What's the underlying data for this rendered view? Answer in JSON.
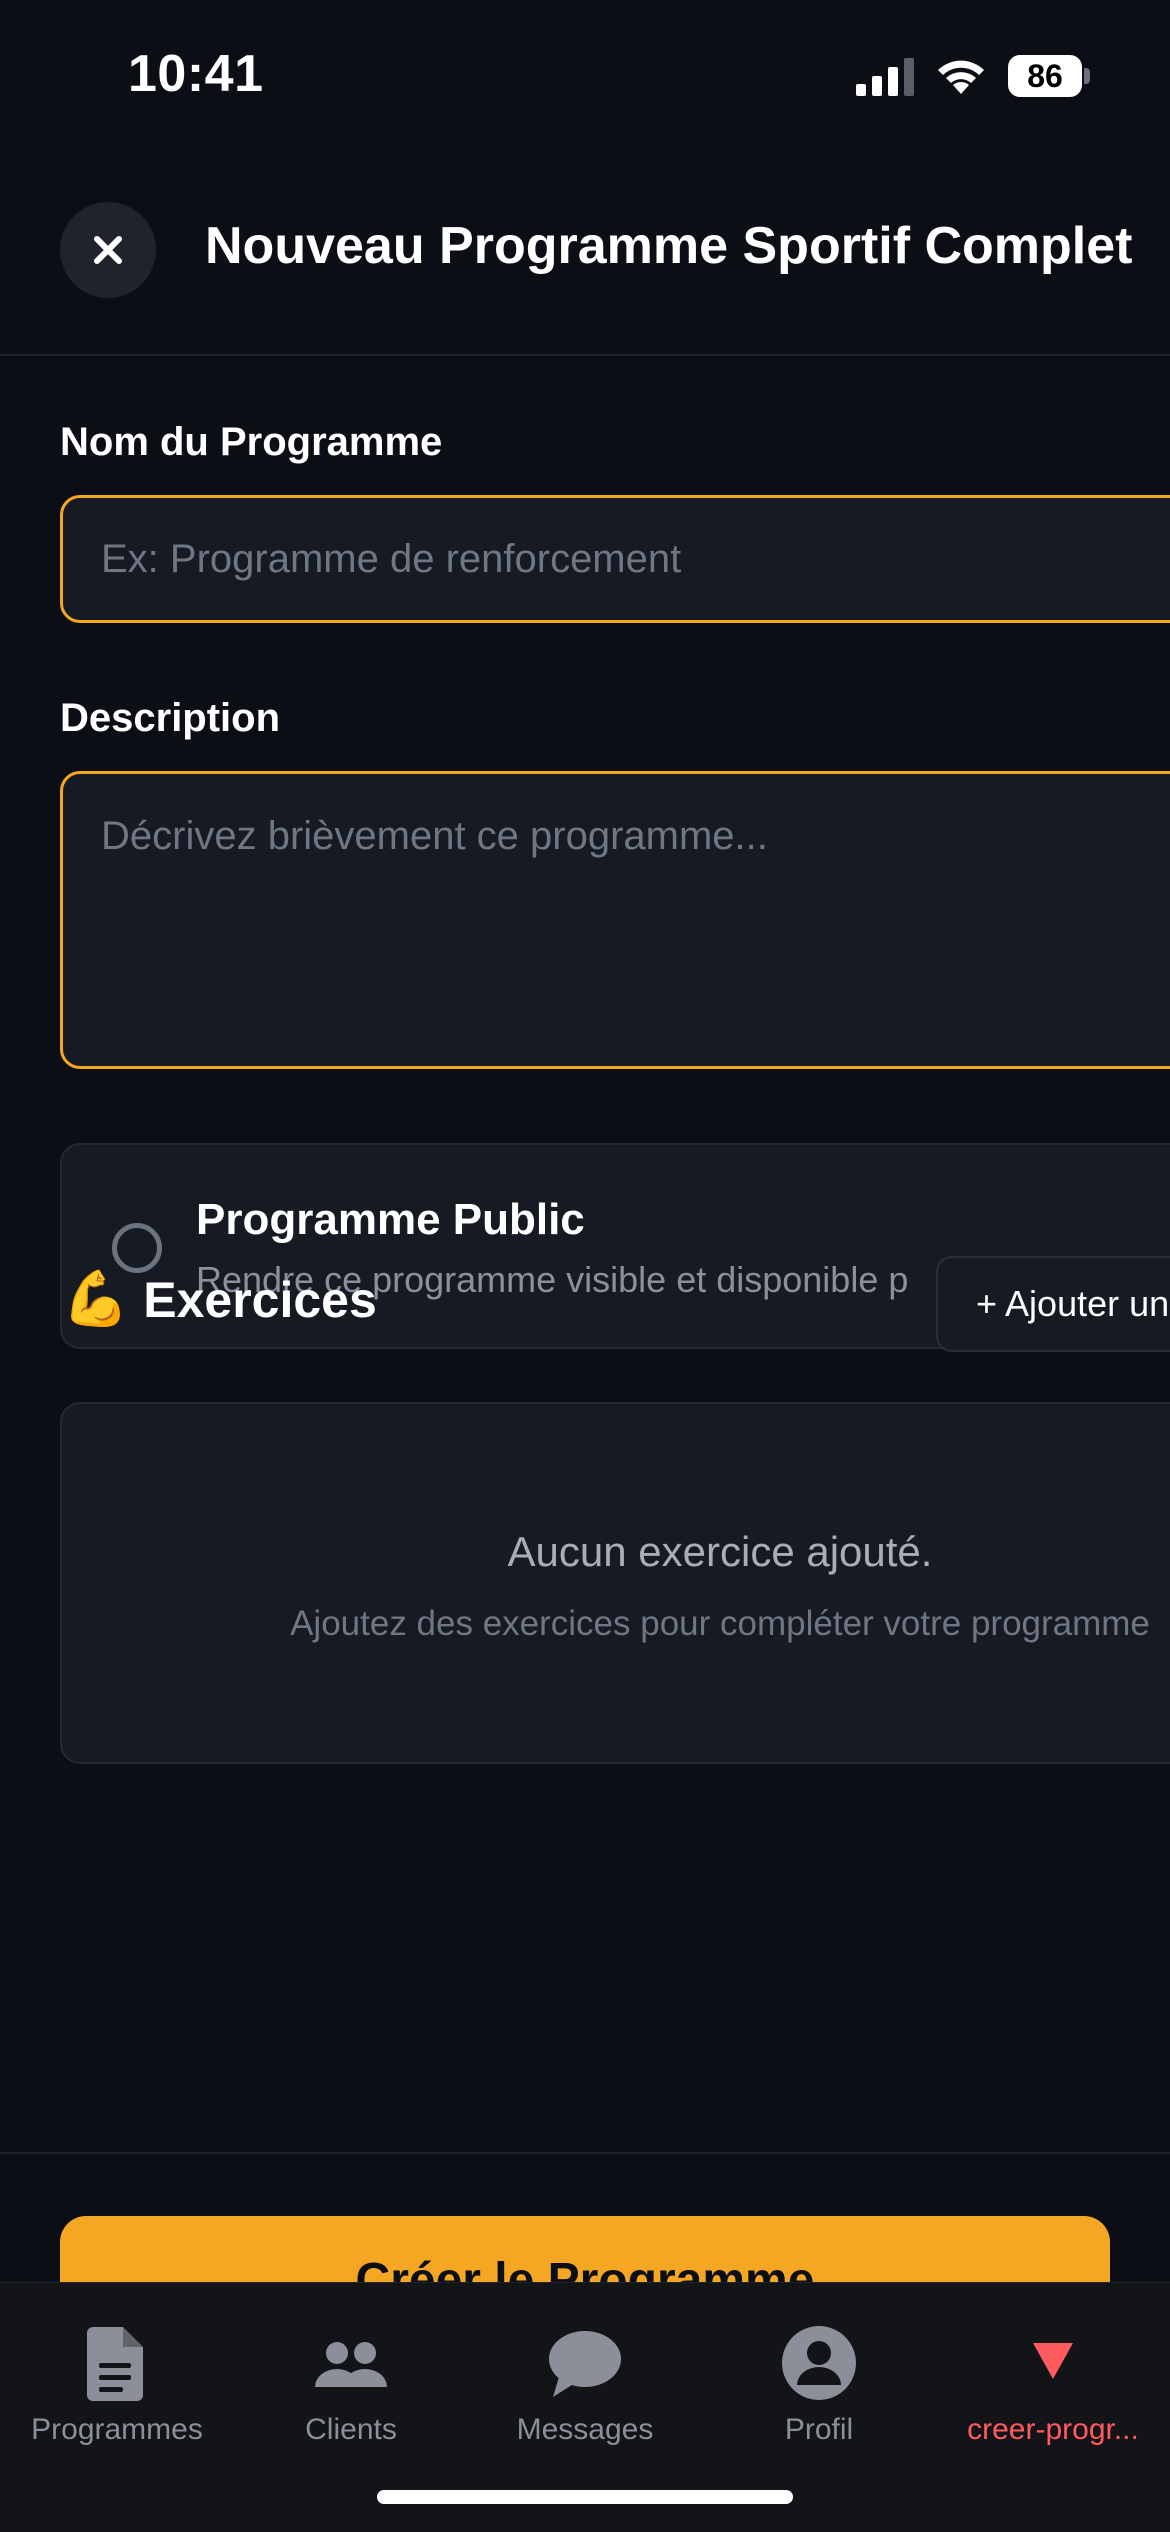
{
  "status_bar": {
    "time": "10:41",
    "battery": "86"
  },
  "header": {
    "close_icon": "close-icon",
    "title": "Nouveau Programme Sportif Complet"
  },
  "form": {
    "name_label": "Nom du Programme",
    "name_placeholder": "Ex: Programme de renforcement",
    "name_value": "",
    "description_label": "Description",
    "description_placeholder": "Décrivez brièvement ce programme...",
    "description_value": ""
  },
  "public_toggle": {
    "title": "Programme Public",
    "subtitle": "Rendre ce programme visible et disponible p",
    "checked": false
  },
  "exercises": {
    "icon": "💪",
    "heading": "Exercices",
    "add_button": "+ Ajouter un",
    "empty_title": "Aucun exercice ajouté.",
    "empty_subtitle": "Ajoutez des exercices pour compléter votre programme"
  },
  "create_button": "Créer le Programme",
  "tabs": [
    {
      "label": "Programmes",
      "icon": "document-icon",
      "active": false
    },
    {
      "label": "Clients",
      "icon": "people-icon",
      "active": false
    },
    {
      "label": "Messages",
      "icon": "chat-bubble-icon",
      "active": false
    },
    {
      "label": "Profil",
      "icon": "person-icon",
      "active": false
    },
    {
      "label": "creer-progr...",
      "icon": "triangle-down-icon",
      "active": true
    }
  ],
  "colors": {
    "accent": "#f5a623",
    "background": "#0b0e15",
    "active_tab": "#ff5a5f"
  }
}
